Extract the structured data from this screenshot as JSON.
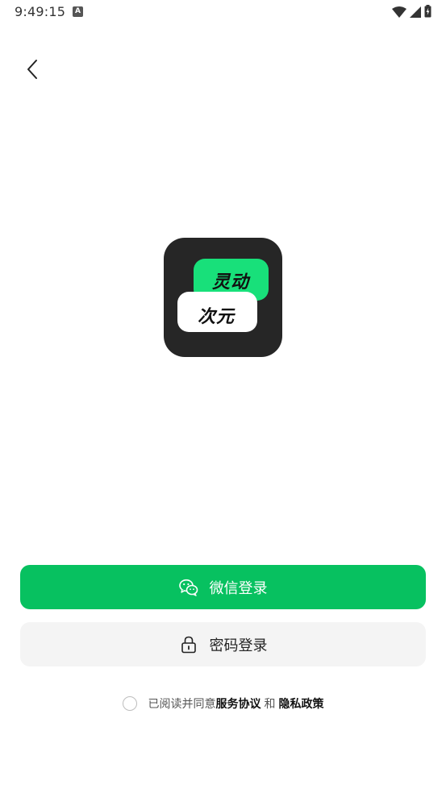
{
  "status_bar": {
    "time": "9:49:15",
    "notification_letter": "A",
    "icons": [
      "wifi-icon",
      "signal-icon",
      "battery-charging-icon"
    ]
  },
  "nav": {
    "back_icon": "chevron-left-icon"
  },
  "logo": {
    "top_text": "灵动",
    "bottom_text": "次元",
    "colors": {
      "background": "#262626",
      "green_bubble": "#18e07a",
      "white_bubble": "#ffffff"
    }
  },
  "actions": {
    "wechat_login": {
      "label": "微信登录",
      "icon": "wechat-icon",
      "color": "#07c160"
    },
    "password_login": {
      "label": "密码登录",
      "icon": "lock-icon",
      "color": "#f4f4f4"
    }
  },
  "agreement": {
    "checked": false,
    "prefix": "已阅读并同意",
    "service_link": "服务协议",
    "connector": "和",
    "privacy_link": "隐私政策"
  }
}
